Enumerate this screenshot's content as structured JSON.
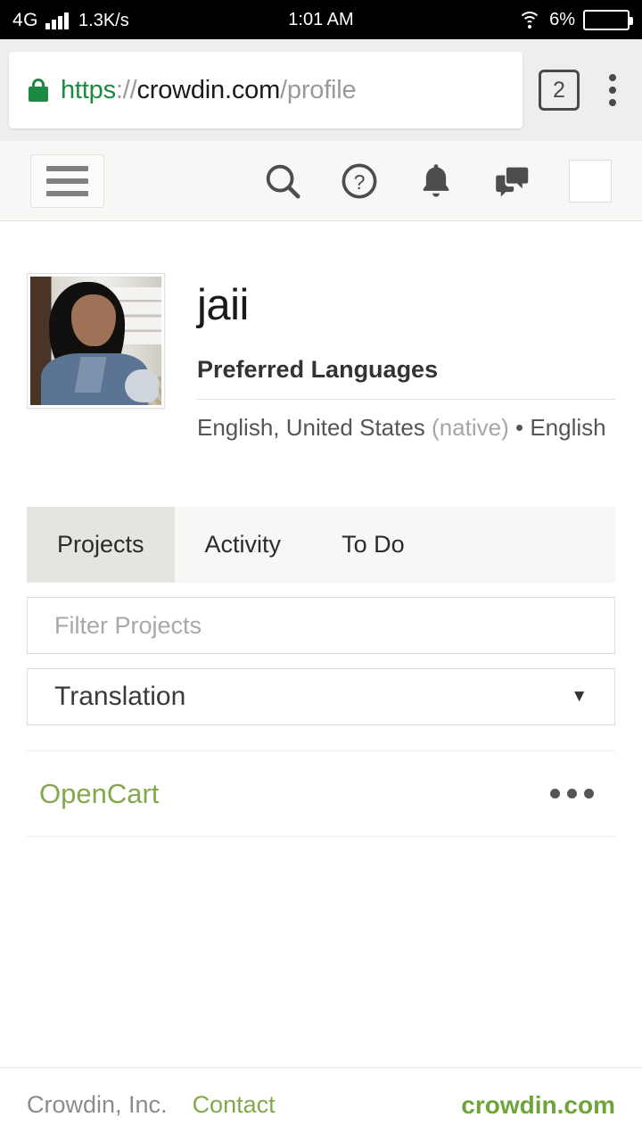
{
  "statusbar": {
    "network": "4G",
    "speed": "1.3K/s",
    "clock": "1:01 AM",
    "battery_percent": "6%",
    "signal_icon": "signal-bars-icon",
    "wifi_icon": "wifi-icon",
    "battery_icon": "battery-icon"
  },
  "browser": {
    "url": {
      "scheme": "https",
      "separator": "://",
      "host": "crowdin.com",
      "path": "/profile"
    },
    "lock_icon": "lock-icon",
    "tab_count": "2",
    "menu_icon": "kebab-menu-icon"
  },
  "sitenav": {
    "menu_icon": "hamburger-menu-icon",
    "icons": [
      {
        "name": "search-icon"
      },
      {
        "name": "help-icon"
      },
      {
        "name": "notifications-bell-icon"
      },
      {
        "name": "messages-icon"
      }
    ],
    "avatar": "user-avatar-thumbnail"
  },
  "profile": {
    "avatar": "user-avatar-large",
    "username": "jaii",
    "languages_label": "Preferred Languages",
    "languages": {
      "primary": "English, United States",
      "native_tag": "(native)",
      "bullet": "•",
      "secondary": "English"
    }
  },
  "tabs": [
    {
      "label": "Projects",
      "active": true
    },
    {
      "label": "Activity",
      "active": false
    },
    {
      "label": "To Do",
      "active": false
    }
  ],
  "filters": {
    "search_placeholder": "Filter Projects",
    "search_value": "",
    "type_select_value": "Translation",
    "type_select_caret": "▼"
  },
  "projects": [
    {
      "name": "OpenCart",
      "more_icon": "more-options-icon"
    }
  ],
  "footer": {
    "company": "Crowdin, Inc.",
    "contact": "Contact",
    "site": "crowdin.com"
  },
  "colors": {
    "accent_green": "#83a94c",
    "link_green": "#6ea43a",
    "lock_green": "#1d8a42",
    "tab_active_bg": "#e4e4e0"
  }
}
